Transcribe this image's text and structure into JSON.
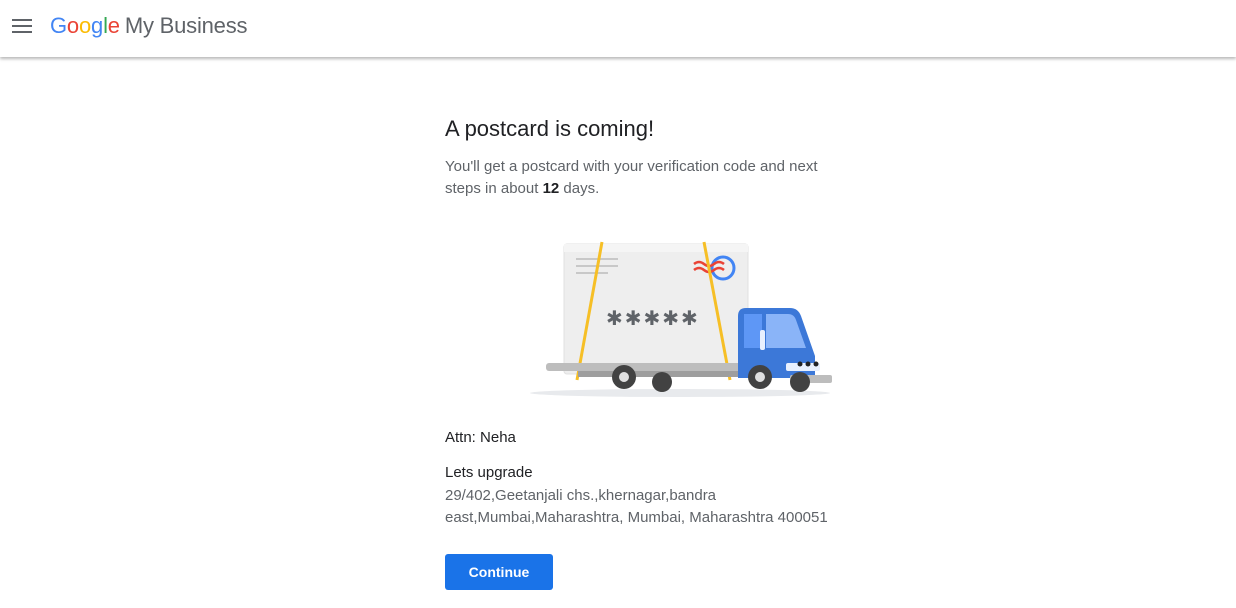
{
  "header": {
    "brand_letters": [
      "G",
      "o",
      "o",
      "g",
      "l",
      "e"
    ],
    "brand_letter_colors": [
      "#4285F4",
      "#EA4335",
      "#FBBC05",
      "#4285F4",
      "#34A853",
      "#EA4335"
    ],
    "product_name": "My Business"
  },
  "main": {
    "title": "A postcard is coming!",
    "description_before": "You'll get a postcard with your verification code and next steps in about ",
    "days": "12",
    "description_after": " days.",
    "postcard_code": "✱✱✱✱✱",
    "attention": "Attn: Neha",
    "business_name": "Lets upgrade",
    "address": "29/402,Geetanjali chs.,khernagar,bandra east,Mumbai,Maharashtra, Mumbai, Maharashtra 400051",
    "continue_label": "Continue"
  },
  "colors": {
    "accent": "#1a73e8",
    "truck_cab": "#3c78d8",
    "truck_cab_dark": "#2a5bb8",
    "strap": "#f6bf26"
  }
}
